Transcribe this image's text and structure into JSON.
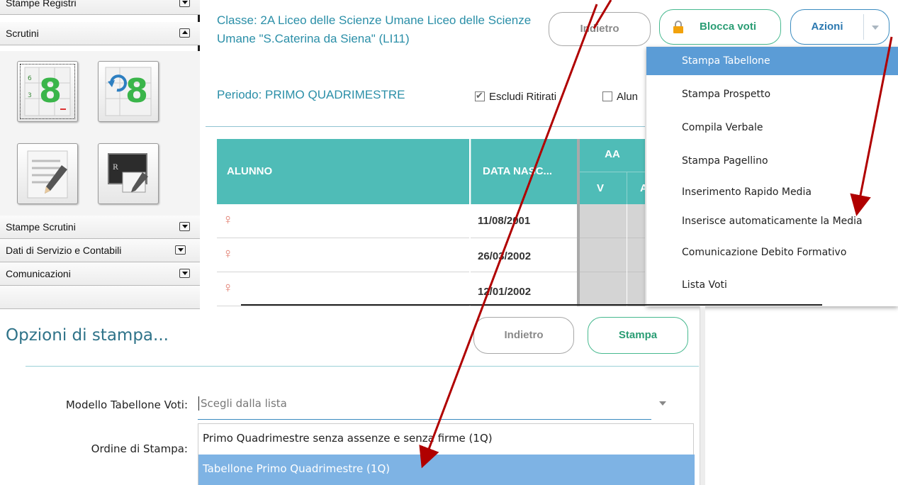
{
  "sidebar": {
    "stampe_registri": "Stampe Registri",
    "scrutini": "Scrutini",
    "stampe_scrutini": "Stampe Scrutini",
    "dati_servizio": "Dati di Servizio e Contabili",
    "comunicazioni": "Comunicazioni",
    "tile_number": "8"
  },
  "header": {
    "classe": "Classe: 2A Liceo delle Scienze Umane Liceo delle Scienze Umane \"S.Caterina da Siena\" (LI11)",
    "periodo": "Periodo: PRIMO QUADRIMESTRE",
    "escludi_ritirati": "Escludi Ritirati",
    "alunni_partial": "Alun"
  },
  "toolbar": {
    "indietro": "Indietro",
    "blocca_voti": "Blocca voti",
    "azioni": "Azioni"
  },
  "table": {
    "col_alunno": "ALUNNO",
    "col_data": "DATA NASC...",
    "col_aa": "AA",
    "sub_v": "V",
    "sub_a": "A",
    "gender_symbol": "♀",
    "rows": [
      {
        "data": "11/08/2001"
      },
      {
        "data": "26/03/2002"
      },
      {
        "data": "12/01/2002"
      }
    ]
  },
  "actions_menu": {
    "items": [
      "Stampa Tabellone",
      "Stampa Prospetto",
      "Compila Verbale",
      "Stampa Pagellino",
      "Inserimento Rapido Media",
      "Inserisce automaticamente la Media",
      "Comunicazione Debito Formativo",
      "Lista Voti"
    ],
    "highlighted": "Stampa Tabellone"
  },
  "print_options": {
    "title": "Opzioni di stampa...",
    "indietro": "Indietro",
    "stampa": "Stampa",
    "modello_label": "Modello Tabellone Voti:",
    "ordine_label": "Ordine di Stampa:",
    "select_placeholder": "Scegli dalla lista",
    "options": [
      "Primo Quadrimestre senza assenze e senza firme (1Q)",
      "Tabellone Primo Quadrimestre (1Q)"
    ],
    "highlighted": "Tabellone Primo Quadrimestre (1Q)"
  },
  "colors": {
    "teal_header": "#4fbcb7",
    "link_teal": "#2b8fa8",
    "menu_highlight": "#5b9cd6",
    "arrow_red": "#b00000"
  }
}
